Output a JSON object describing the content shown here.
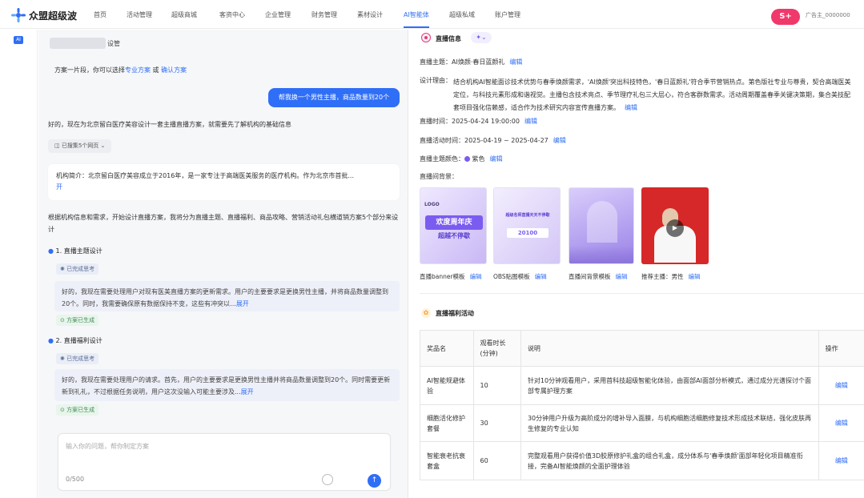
{
  "brand": "众盟超级波",
  "nav": [
    "首页",
    "活动管理",
    "超级商城",
    "客资中心",
    "企业管理",
    "财务管理",
    "素材设计",
    "AI智能体",
    "超级私域",
    "账户管理"
  ],
  "user": {
    "badge": "S+",
    "name": "广告主_0000000"
  },
  "rail": {
    "ai": "AI"
  },
  "chat": {
    "header_suffix": "设管",
    "plan_line": {
      "prefix": "方案一片段，你可以选择",
      "link1": "专业方案",
      "mid": "或",
      "link2": "确认方案"
    },
    "user_msg": "帮我换一个男性主播，商品数量到20个",
    "reply_intro": "好的，现在为北京留白医疗美容设计一套主播直播方案，就需要先了解机构的基础信息",
    "collapsed": "已搜集5个网页",
    "org_card": {
      "text": "机构简介：北京留白医疗美容成立于2016年，是一家专注于高端医美服务的医疗机构。作为北京市首批...",
      "more": "开"
    },
    "design_intro": "根据机构信息和需求，开始设计直播方案，我将分为直播主题、直播福利、商品攻略、营销活动礼包横道销方案5个部分来设计",
    "sections": [
      {
        "title": "1. 直播主题设计",
        "tag": "已完成思考",
        "text": "好的，我现在需要处理用户对现有医美直播方案的更新需求。用户的主要要求是更换男性主播，并将商品数量调整到20个。同时，我需要确保原有数据保持不变，这些有冲突以...",
        "more": "展开",
        "done": "方案已生成"
      },
      {
        "title": "2. 直播福利设计",
        "tag": "已完成思考",
        "text": "好的，我现在需要处理用户的请求。首先，用户的主要要求是更换男性主播并将商品数量调整到20个。同时需要更新新到礼礼，不过根据任务说明，用户这次没输入可能主要涉及...",
        "more": "展开",
        "done": "方案已生成"
      }
    ],
    "input": {
      "placeholder": "输入你的问题，帮你制定方案",
      "counter": "0/500"
    }
  },
  "panel": {
    "title": "直播信息",
    "fields": {
      "theme_label": "直播主题：",
      "theme_value": "AI焕颜·春日蓝颜礼",
      "reason_label": "设计理由：",
      "reason_value": "结合机构AI智能面诊技术优势与春季焕颜需求，'AI焕颜'突出科技特色，'春日蓝颜礼'符合季节营销热点。第色版社专业与尊贵，契合高端医美定位，与科技元素形成和谐视觉。主播包含技术亮点、季节理疗礼包三大层心，符合客群数需求。活动周期覆盖春季关键决策期，集合美技配套项目强化信赖感，适合作为技术研究内容宣传直播方案。",
      "time_label": "直播时间：",
      "time_value": "2025-04-24 19:00:00",
      "period_label": "直播活动时间：",
      "period_value": "2025-04-19 ~ 2025-04-27",
      "color_label": "直播主题颜色：",
      "color_value": "紫色",
      "thumbs_label": "直播间背景：",
      "edit": "编辑"
    },
    "thumbs": [
      {
        "caption": "直播banner模板",
        "t1": "LOGO",
        "t2": "欢度周年庆",
        "t3": "超越不停歇"
      },
      {
        "caption": "OBS贴图模板",
        "t1": "超级名师直播天天不停歇",
        "t2": "20100"
      },
      {
        "caption": "直播间背景模板"
      },
      {
        "caption": "推荐主播：男性"
      }
    ],
    "welfare": {
      "title": "直播福利活动",
      "headers": [
        "奖品名",
        "观看时长(分钟)",
        "说明",
        "操作"
      ],
      "rows": [
        {
          "name": "AI智能规避体验",
          "mins": "10",
          "desc": "针对10分钟观看用户，采用首科技超级智能化体验，由面部AI面部分析模式，通过成分光谱探讨个面部专属护理方案",
          "op": "编辑"
        },
        {
          "name": "细胞活化修护套餐",
          "mins": "30",
          "desc": "30分钟用户升级为高阶成分的增补导入面膜，与机构细胞活细胞修复技术形成技术联结，强化皮肤再生修复的专业认知",
          "op": "编辑"
        },
        {
          "name": "智能衰老抗衰套盒",
          "mins": "60",
          "desc": "完整观看用户获得价值3D胶原修护礼盒的组合礼盒，成分体系与'春季焕颜'面部年轻化项目精准衔接，完备AI智能焕颜的全面护理体验",
          "op": "编辑"
        }
      ]
    }
  },
  "colors": {
    "accent": "#2f6ef6",
    "purple": "#7b5cf0",
    "pink": "#f0386b"
  }
}
